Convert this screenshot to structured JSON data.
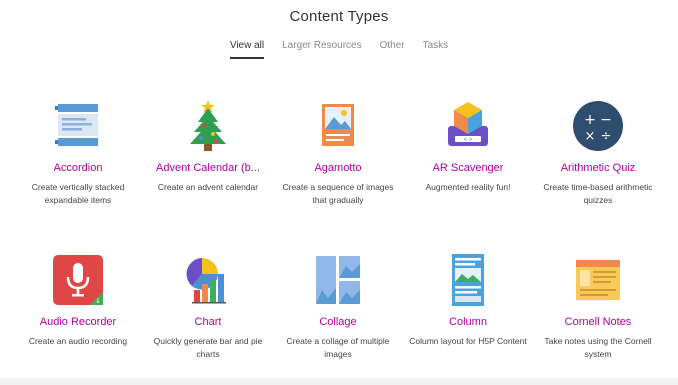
{
  "page": {
    "title": "Content Types"
  },
  "tabs": [
    {
      "label": "View all",
      "active": true
    },
    {
      "label": "Larger Resources",
      "active": false
    },
    {
      "label": "Other",
      "active": false
    },
    {
      "label": "Tasks",
      "active": false
    }
  ],
  "cards": [
    {
      "title": "Accordion",
      "description": "Create vertically stacked expandable items",
      "icon": "accordion-icon"
    },
    {
      "title": "Advent Calendar (b...",
      "description": "Create an advent calendar",
      "icon": "christmas-tree-icon"
    },
    {
      "title": "Agamotto",
      "description": "Create a sequence of images that gradually",
      "icon": "image-sequence-icon"
    },
    {
      "title": "AR Scavenger",
      "description": "Augmented reality fun!",
      "icon": "ar-cube-icon"
    },
    {
      "title": "Arithmetic Quiz",
      "description": "Create time-based arithmetic quizzes",
      "icon": "arithmetic-icon"
    },
    {
      "title": "Audio Recorder",
      "description": "Create an audio recording",
      "icon": "microphone-icon"
    },
    {
      "title": "Chart",
      "description": "Quickly generate bar and pie charts",
      "icon": "chart-icon"
    },
    {
      "title": "Collage",
      "description": "Create a collage of multiple images",
      "icon": "collage-icon"
    },
    {
      "title": "Column",
      "description": "Column layout for H5P Content",
      "icon": "column-icon"
    },
    {
      "title": "Cornell Notes",
      "description": "Take notes using the Cornell system",
      "icon": "cornell-notes-icon"
    }
  ],
  "colors": {
    "title_accent": "#b4009e",
    "tab_active": "#333333",
    "tab_inactive": "#8a8a8a"
  }
}
